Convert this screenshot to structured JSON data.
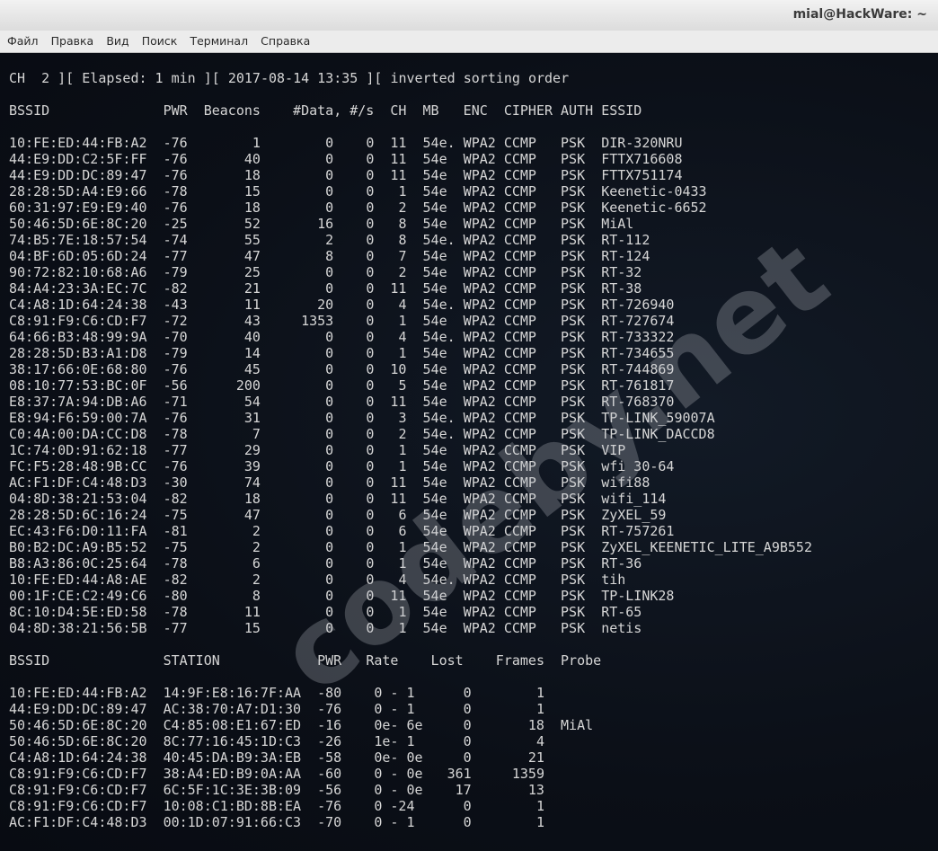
{
  "window": {
    "title": "mial@HackWare: ~"
  },
  "menu": [
    "Файл",
    "Правка",
    "Вид",
    "Поиск",
    "Терминал",
    "Справка"
  ],
  "status_line": "CH  2 ][ Elapsed: 1 min ][ 2017-08-14 13:35 ][ inverted sorting order",
  "watermark": "codeby.net",
  "ap_table": {
    "headers": {
      "bssid": "BSSID",
      "pwr": "PWR",
      "beacons": "Beacons",
      "data": "#Data,",
      "rate": "#/s",
      "ch": "CH",
      "mb": "MB",
      "enc": "ENC",
      "cipher": "CIPHER",
      "auth": "AUTH",
      "essid": "ESSID"
    },
    "rows": [
      {
        "bssid": "10:FE:ED:44:FB:A2",
        "pwr": "-76",
        "beacons": "1",
        "data": "0",
        "rate": "0",
        "ch": "11",
        "mb": "54e.",
        "enc": "WPA2",
        "cipher": "CCMP",
        "auth": "PSK",
        "essid": "DIR-320NRU"
      },
      {
        "bssid": "44:E9:DD:C2:5F:FF",
        "pwr": "-76",
        "beacons": "40",
        "data": "0",
        "rate": "0",
        "ch": "11",
        "mb": "54e",
        "enc": "WPA2",
        "cipher": "CCMP",
        "auth": "PSK",
        "essid": "FTTX716608"
      },
      {
        "bssid": "44:E9:DD:DC:89:47",
        "pwr": "-76",
        "beacons": "18",
        "data": "0",
        "rate": "0",
        "ch": "11",
        "mb": "54e",
        "enc": "WPA2",
        "cipher": "CCMP",
        "auth": "PSK",
        "essid": "FTTX751174"
      },
      {
        "bssid": "28:28:5D:A4:E9:66",
        "pwr": "-78",
        "beacons": "15",
        "data": "0",
        "rate": "0",
        "ch": "1",
        "mb": "54e",
        "enc": "WPA2",
        "cipher": "CCMP",
        "auth": "PSK",
        "essid": "Keenetic-0433"
      },
      {
        "bssid": "60:31:97:E9:E9:40",
        "pwr": "-76",
        "beacons": "18",
        "data": "0",
        "rate": "0",
        "ch": "2",
        "mb": "54e",
        "enc": "WPA2",
        "cipher": "CCMP",
        "auth": "PSK",
        "essid": "Keenetic-6652"
      },
      {
        "bssid": "50:46:5D:6E:8C:20",
        "pwr": "-25",
        "beacons": "52",
        "data": "16",
        "rate": "0",
        "ch": "8",
        "mb": "54e",
        "enc": "WPA2",
        "cipher": "CCMP",
        "auth": "PSK",
        "essid": "MiAl"
      },
      {
        "bssid": "74:B5:7E:18:57:54",
        "pwr": "-74",
        "beacons": "55",
        "data": "2",
        "rate": "0",
        "ch": "8",
        "mb": "54e.",
        "enc": "WPA2",
        "cipher": "CCMP",
        "auth": "PSK",
        "essid": "RT-112"
      },
      {
        "bssid": "04:BF:6D:05:6D:24",
        "pwr": "-77",
        "beacons": "47",
        "data": "8",
        "rate": "0",
        "ch": "7",
        "mb": "54e",
        "enc": "WPA2",
        "cipher": "CCMP",
        "auth": "PSK",
        "essid": "RT-124"
      },
      {
        "bssid": "90:72:82:10:68:A6",
        "pwr": "-79",
        "beacons": "25",
        "data": "0",
        "rate": "0",
        "ch": "2",
        "mb": "54e",
        "enc": "WPA2",
        "cipher": "CCMP",
        "auth": "PSK",
        "essid": "RT-32"
      },
      {
        "bssid": "84:A4:23:3A:EC:7C",
        "pwr": "-82",
        "beacons": "21",
        "data": "0",
        "rate": "0",
        "ch": "11",
        "mb": "54e",
        "enc": "WPA2",
        "cipher": "CCMP",
        "auth": "PSK",
        "essid": "RT-38"
      },
      {
        "bssid": "C4:A8:1D:64:24:38",
        "pwr": "-43",
        "beacons": "11",
        "data": "20",
        "rate": "0",
        "ch": "4",
        "mb": "54e.",
        "enc": "WPA2",
        "cipher": "CCMP",
        "auth": "PSK",
        "essid": "RT-726940"
      },
      {
        "bssid": "C8:91:F9:C6:CD:F7",
        "pwr": "-72",
        "beacons": "43",
        "data": "1353",
        "rate": "0",
        "ch": "1",
        "mb": "54e",
        "enc": "WPA2",
        "cipher": "CCMP",
        "auth": "PSK",
        "essid": "RT-727674"
      },
      {
        "bssid": "64:66:B3:48:99:9A",
        "pwr": "-70",
        "beacons": "40",
        "data": "0",
        "rate": "0",
        "ch": "4",
        "mb": "54e.",
        "enc": "WPA2",
        "cipher": "CCMP",
        "auth": "PSK",
        "essid": "RT-733322"
      },
      {
        "bssid": "28:28:5D:B3:A1:D8",
        "pwr": "-79",
        "beacons": "14",
        "data": "0",
        "rate": "0",
        "ch": "1",
        "mb": "54e",
        "enc": "WPA2",
        "cipher": "CCMP",
        "auth": "PSK",
        "essid": "RT-734655"
      },
      {
        "bssid": "38:17:66:0E:68:80",
        "pwr": "-76",
        "beacons": "45",
        "data": "0",
        "rate": "0",
        "ch": "10",
        "mb": "54e",
        "enc": "WPA2",
        "cipher": "CCMP",
        "auth": "PSK",
        "essid": "RT-744869"
      },
      {
        "bssid": "08:10:77:53:BC:0F",
        "pwr": "-56",
        "beacons": "200",
        "data": "0",
        "rate": "0",
        "ch": "5",
        "mb": "54e",
        "enc": "WPA2",
        "cipher": "CCMP",
        "auth": "PSK",
        "essid": "RT-761817"
      },
      {
        "bssid": "E8:37:7A:94:DB:A6",
        "pwr": "-71",
        "beacons": "54",
        "data": "0",
        "rate": "0",
        "ch": "11",
        "mb": "54e",
        "enc": "WPA2",
        "cipher": "CCMP",
        "auth": "PSK",
        "essid": "RT-768370"
      },
      {
        "bssid": "E8:94:F6:59:00:7A",
        "pwr": "-76",
        "beacons": "31",
        "data": "0",
        "rate": "0",
        "ch": "3",
        "mb": "54e.",
        "enc": "WPA2",
        "cipher": "CCMP",
        "auth": "PSK",
        "essid": "TP-LINK_59007A"
      },
      {
        "bssid": "C0:4A:00:DA:CC:D8",
        "pwr": "-78",
        "beacons": "7",
        "data": "0",
        "rate": "0",
        "ch": "2",
        "mb": "54e.",
        "enc": "WPA2",
        "cipher": "CCMP",
        "auth": "PSK",
        "essid": "TP-LINK_DACCD8"
      },
      {
        "bssid": "1C:74:0D:91:62:18",
        "pwr": "-77",
        "beacons": "29",
        "data": "0",
        "rate": "0",
        "ch": "1",
        "mb": "54e",
        "enc": "WPA2",
        "cipher": "CCMP",
        "auth": "PSK",
        "essid": "VIP"
      },
      {
        "bssid": "FC:F5:28:48:9B:CC",
        "pwr": "-76",
        "beacons": "39",
        "data": "0",
        "rate": "0",
        "ch": "1",
        "mb": "54e",
        "enc": "WPA2",
        "cipher": "CCMP",
        "auth": "PSK",
        "essid": "wfi 30-64"
      },
      {
        "bssid": "AC:F1:DF:C4:48:D3",
        "pwr": "-30",
        "beacons": "74",
        "data": "0",
        "rate": "0",
        "ch": "11",
        "mb": "54e",
        "enc": "WPA2",
        "cipher": "CCMP",
        "auth": "PSK",
        "essid": "wifi88"
      },
      {
        "bssid": "04:8D:38:21:53:04",
        "pwr": "-82",
        "beacons": "18",
        "data": "0",
        "rate": "0",
        "ch": "11",
        "mb": "54e",
        "enc": "WPA2",
        "cipher": "CCMP",
        "auth": "PSK",
        "essid": "wifi_114"
      },
      {
        "bssid": "28:28:5D:6C:16:24",
        "pwr": "-75",
        "beacons": "47",
        "data": "0",
        "rate": "0",
        "ch": "6",
        "mb": "54e",
        "enc": "WPA2",
        "cipher": "CCMP",
        "auth": "PSK",
        "essid": "ZyXEL_59"
      },
      {
        "bssid": "EC:43:F6:D0:11:FA",
        "pwr": "-81",
        "beacons": "2",
        "data": "0",
        "rate": "0",
        "ch": "6",
        "mb": "54e",
        "enc": "WPA2",
        "cipher": "CCMP",
        "auth": "PSK",
        "essid": "RT-757261"
      },
      {
        "bssid": "B0:B2:DC:A9:B5:52",
        "pwr": "-75",
        "beacons": "2",
        "data": "0",
        "rate": "0",
        "ch": "1",
        "mb": "54e",
        "enc": "WPA2",
        "cipher": "CCMP",
        "auth": "PSK",
        "essid": "ZyXEL_KEENETIC_LITE_A9B552"
      },
      {
        "bssid": "B8:A3:86:0C:25:64",
        "pwr": "-78",
        "beacons": "6",
        "data": "0",
        "rate": "0",
        "ch": "1",
        "mb": "54e",
        "enc": "WPA2",
        "cipher": "CCMP",
        "auth": "PSK",
        "essid": "RT-36"
      },
      {
        "bssid": "10:FE:ED:44:A8:AE",
        "pwr": "-82",
        "beacons": "2",
        "data": "0",
        "rate": "0",
        "ch": "4",
        "mb": "54e.",
        "enc": "WPA2",
        "cipher": "CCMP",
        "auth": "PSK",
        "essid": "tih"
      },
      {
        "bssid": "00:1F:CE:C2:49:C6",
        "pwr": "-80",
        "beacons": "8",
        "data": "0",
        "rate": "0",
        "ch": "11",
        "mb": "54e",
        "enc": "WPA2",
        "cipher": "CCMP",
        "auth": "PSK",
        "essid": "TP-LINK28"
      },
      {
        "bssid": "8C:10:D4:5E:ED:58",
        "pwr": "-78",
        "beacons": "11",
        "data": "0",
        "rate": "0",
        "ch": "1",
        "mb": "54e",
        "enc": "WPA2",
        "cipher": "CCMP",
        "auth": "PSK",
        "essid": "RT-65"
      },
      {
        "bssid": "04:8D:38:21:56:5B",
        "pwr": "-77",
        "beacons": "15",
        "data": "0",
        "rate": "0",
        "ch": "1",
        "mb": "54e",
        "enc": "WPA2",
        "cipher": "CCMP",
        "auth": "PSK",
        "essid": "netis"
      }
    ]
  },
  "station_table": {
    "headers": {
      "bssid": "BSSID",
      "station": "STATION",
      "pwr": "PWR",
      "rate": "Rate",
      "lost": "Lost",
      "frames": "Frames",
      "probe": "Probe"
    },
    "rows": [
      {
        "bssid": "10:FE:ED:44:FB:A2",
        "station": "14:9F:E8:16:7F:AA",
        "pwr": "-80",
        "rate": "0 - 1",
        "lost": "0",
        "frames": "1",
        "probe": ""
      },
      {
        "bssid": "44:E9:DD:DC:89:47",
        "station": "AC:38:70:A7:D1:30",
        "pwr": "-76",
        "rate": "0 - 1",
        "lost": "0",
        "frames": "1",
        "probe": ""
      },
      {
        "bssid": "50:46:5D:6E:8C:20",
        "station": "C4:85:08:E1:67:ED",
        "pwr": "-16",
        "rate": "0e- 6e",
        "lost": "0",
        "frames": "18",
        "probe": "MiAl"
      },
      {
        "bssid": "50:46:5D:6E:8C:20",
        "station": "8C:77:16:45:1D:C3",
        "pwr": "-26",
        "rate": "1e- 1",
        "lost": "0",
        "frames": "4",
        "probe": ""
      },
      {
        "bssid": "C4:A8:1D:64:24:38",
        "station": "40:45:DA:B9:3A:EB",
        "pwr": "-58",
        "rate": "0e- 0e",
        "lost": "0",
        "frames": "21",
        "probe": ""
      },
      {
        "bssid": "C8:91:F9:C6:CD:F7",
        "station": "38:A4:ED:B9:0A:AA",
        "pwr": "-60",
        "rate": "0 - 0e",
        "lost": "361",
        "frames": "1359",
        "probe": ""
      },
      {
        "bssid": "C8:91:F9:C6:CD:F7",
        "station": "6C:5F:1C:3E:3B:09",
        "pwr": "-56",
        "rate": "0 - 0e",
        "lost": "17",
        "frames": "13",
        "probe": ""
      },
      {
        "bssid": "C8:91:F9:C6:CD:F7",
        "station": "10:08:C1:BD:8B:EA",
        "pwr": "-76",
        "rate": "0 -24",
        "lost": "0",
        "frames": "1",
        "probe": ""
      },
      {
        "bssid": "AC:F1:DF:C4:48:D3",
        "station": "00:1D:07:91:66:C3",
        "pwr": "-70",
        "rate": "0 - 1",
        "lost": "0",
        "frames": "1",
        "probe": ""
      }
    ]
  }
}
